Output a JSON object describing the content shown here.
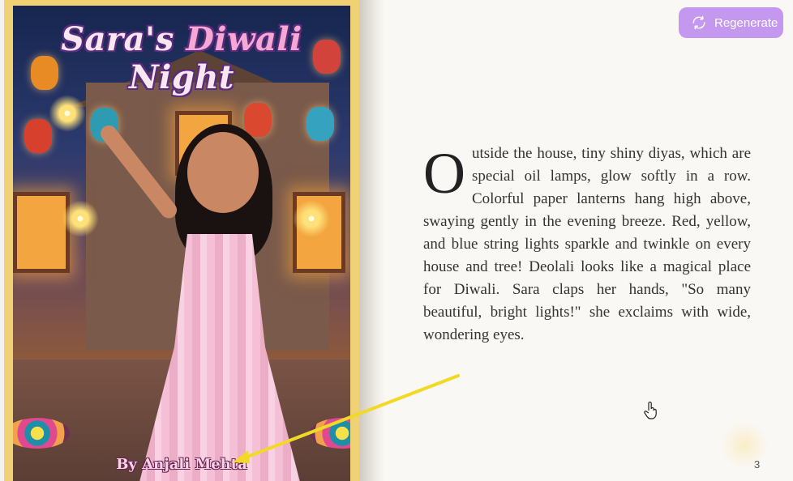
{
  "cover": {
    "title_part1": "Sara's ",
    "title_part2": "Diwali",
    "title_part3": " Night",
    "author": "By Anjali Mehta"
  },
  "toolbar": {
    "regenerate_label": "Regenerate",
    "regenerate_icon": "refresh-icon"
  },
  "story": {
    "dropcap": "O",
    "text": "utside the house, tiny shiny diyas, which are special oil lamps, glow softly in a row. Colorful paper lanterns hang high above, swaying gently in the evening breeze. Red, yellow, and blue string lights sparkle and twinkle on every house and tree! Deolali looks like a magical place for Diwali. Sara claps her hands, \"So many beautiful, bright lights!\" she exclaims with wide, wondering eyes."
  },
  "page_number": "3",
  "colors": {
    "accent": "#c498ef",
    "cover_border": "#f0d173",
    "annotation_arrow": "#f2d925"
  }
}
